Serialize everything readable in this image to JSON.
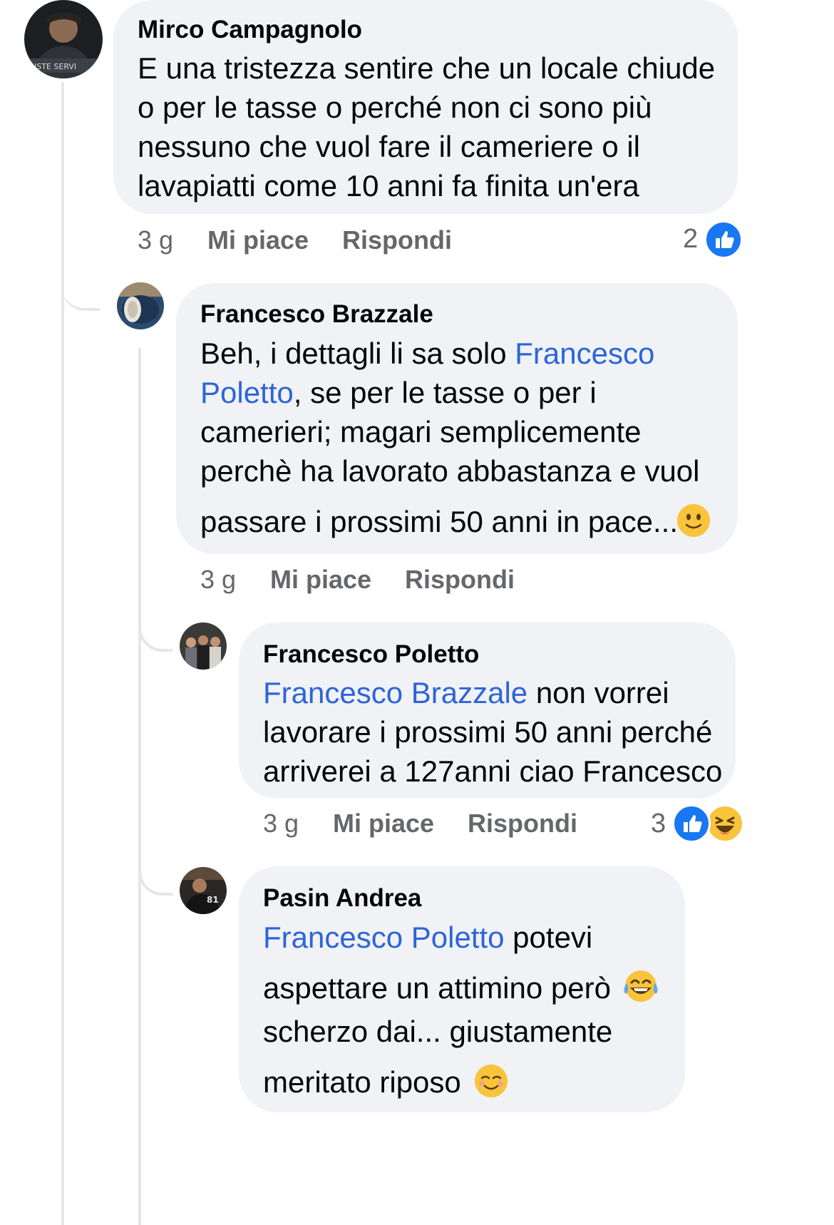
{
  "comments": [
    {
      "author": "Mirco Campagnolo",
      "lines": [
        "E una tristezza sentire che un locale chiude",
        "o per le tasse o perché non ci sono più",
        "nessuno che vuol fare il cameriere o il",
        "lavapiatti come 10 anni fa finita  un'era"
      ],
      "time": "3 g",
      "like_label": "Mi piace",
      "reply_label": "Rispondi",
      "reaction_count": "2",
      "reactions": [
        "like-icon"
      ]
    },
    {
      "author": "Francesco Brazzale",
      "line1_pre": "Beh, i dettagli li sa solo ",
      "line1_mention": "Francesco",
      "line2_mention": "Poletto",
      "line2_post": ", se per le tasse o per i",
      "line3": "camerieri; magari  semplicemente",
      "line4": "perchè ha lavorato abbastanza e vuol",
      "line5": "passare i prossimi 50 anni in pace...",
      "line5_emoji": "slightly-smiling-face",
      "time": "3 g",
      "like_label": "Mi piace",
      "reply_label": "Rispondi"
    },
    {
      "author": "Francesco Poletto",
      "line1_mention": "Francesco Brazzale",
      "line1_post": " non vorrei",
      "line2": "lavorare i prossimi 50 anni perché",
      "line3": "arriverei a 127anni ciao Francesco",
      "time": "3 g",
      "like_label": "Mi piace",
      "reply_label": "Rispondi",
      "reaction_count": "3",
      "reactions": [
        "like-icon",
        "laughing-icon"
      ]
    },
    {
      "author": "Pasin Andrea",
      "line1_mention": "Francesco Poletto",
      "line1_post": " potevi",
      "line2": "aspettare un attimino però",
      "line2_emoji": "tears-of-joy",
      "line3": "scherzo dai... giustamente",
      "line4": "meritato riposo",
      "line4_emoji": "smiling-face"
    }
  ],
  "colors": {
    "bubble": "#f0f2f5",
    "mention": "#2d64d8",
    "meta": "#65676b",
    "like_blue": "#1877f2",
    "emoji_yellow": "#f7c43b"
  }
}
